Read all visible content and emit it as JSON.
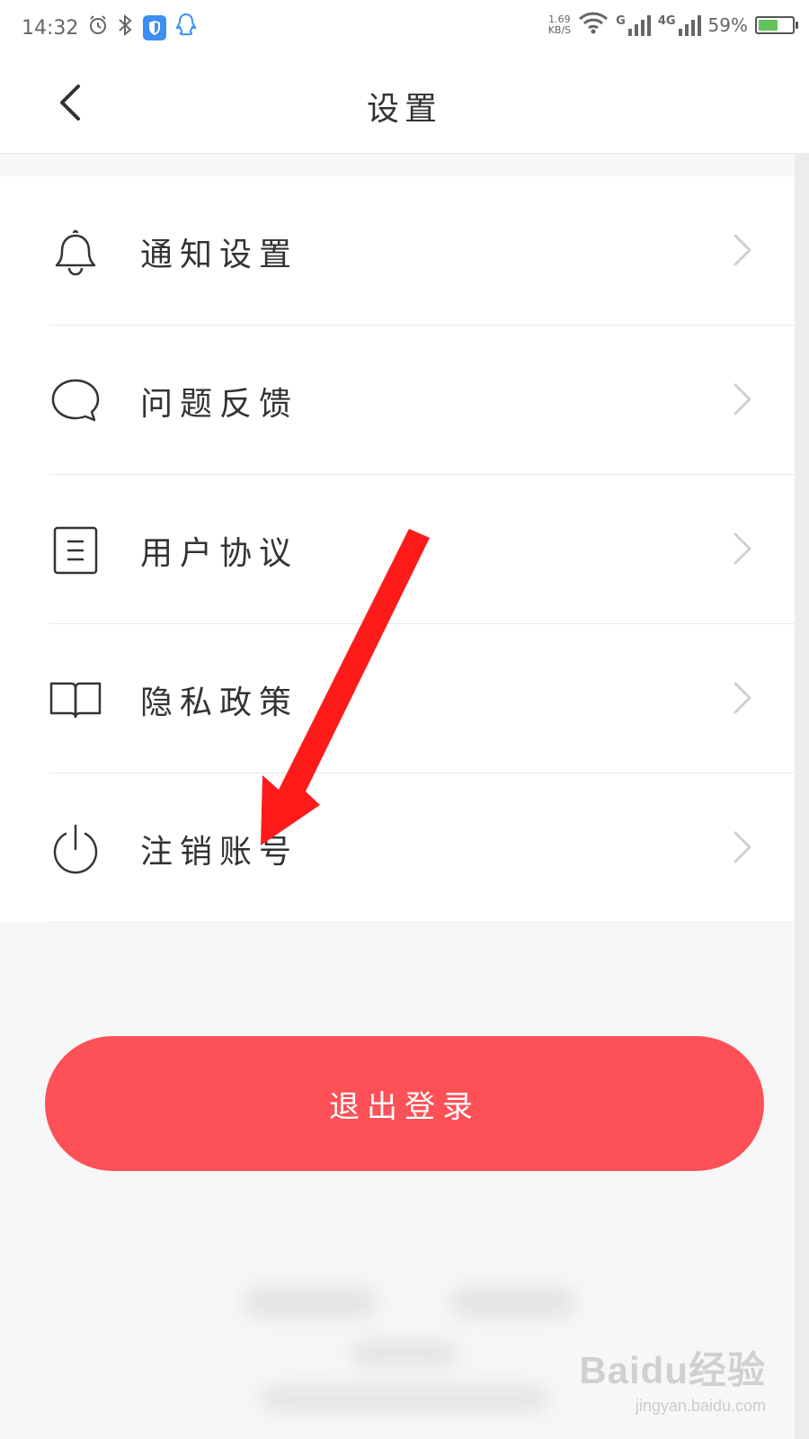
{
  "status_bar": {
    "time": "14:32",
    "net_speed_value": "1.69",
    "net_speed_unit": "KB/S",
    "signal_1_label": "G",
    "signal_2_label": "4G",
    "battery": "59%",
    "battery_level": 0.59,
    "icons": [
      "alarm-icon",
      "bluetooth-icon",
      "shield-icon",
      "qq-icon",
      "wifi-icon",
      "signal-icon",
      "battery-icon"
    ]
  },
  "header": {
    "title": "设置",
    "back_icon": "chevron-left-icon"
  },
  "menu": {
    "items": [
      {
        "label": "通知设置",
        "icon": "bell-icon"
      },
      {
        "label": "问题反馈",
        "icon": "chat-bubble-icon"
      },
      {
        "label": "用户协议",
        "icon": "document-icon"
      },
      {
        "label": "隐私政策",
        "icon": "book-icon"
      },
      {
        "label": "注销账号",
        "icon": "power-icon"
      }
    ]
  },
  "logout": {
    "label": "退出登录",
    "color": "#fd5157"
  },
  "watermark": {
    "logo": "Baidu经验",
    "url": "jingyan.baidu.com"
  },
  "colors": {
    "accent": "#fd5157",
    "annotation_arrow": "#ff1a1a",
    "battery": "#61c35a"
  }
}
